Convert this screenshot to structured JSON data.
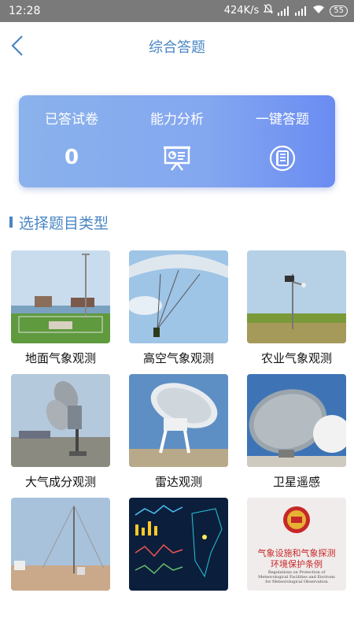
{
  "status_bar": {
    "time": "12:28",
    "speed": "424K/s",
    "battery": "55"
  },
  "header": {
    "title": "综合答题"
  },
  "summary_card": {
    "answered_label": "已答试卷",
    "answered_value": "0",
    "analysis_label": "能力分析",
    "quick_label": "一键答题"
  },
  "section": {
    "title": "选择题目类型"
  },
  "categories": [
    {
      "label": "地面气象观测",
      "icon": "ground-station-image"
    },
    {
      "label": "高空气象观测",
      "icon": "weather-balloon-image"
    },
    {
      "label": "农业气象观测",
      "icon": "agri-station-image"
    },
    {
      "label": "大气成分观测",
      "icon": "atmosphere-instrument-image"
    },
    {
      "label": "雷达观测",
      "icon": "radar-dish-image"
    },
    {
      "label": "卫星遥感",
      "icon": "satellite-dish-image"
    },
    {
      "label": "",
      "icon": "field-station-image"
    },
    {
      "label": "",
      "icon": "data-dashboard-image"
    },
    {
      "label": "",
      "icon": "regulations-cover-image"
    }
  ],
  "regulations_cover": {
    "cn_title_1": "气象设施和气象探测",
    "cn_title_2": "环境保护条例",
    "en_text": "Regulations on Protection of Meteorological Facilities and Environs for Meteorological Observation"
  },
  "colors": {
    "accent": "#4a86c5",
    "card_start": "#8ab2ec",
    "card_end": "#6a8cf2"
  }
}
